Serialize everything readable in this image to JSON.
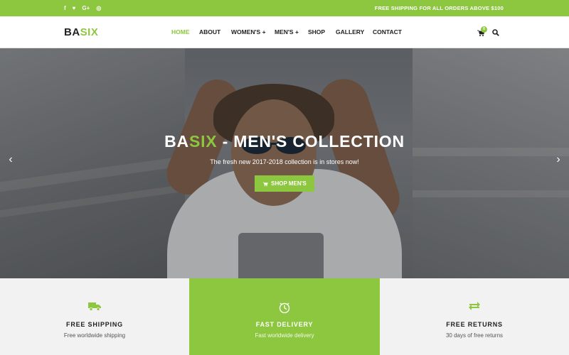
{
  "colors": {
    "accent": "#8dc63f",
    "dark": "#222222",
    "light_panel": "#f2f2f2"
  },
  "topbar": {
    "social": [
      {
        "icon": "facebook-icon",
        "glyph": "f"
      },
      {
        "icon": "twitter-icon",
        "glyph": "♥"
      },
      {
        "icon": "google-plus-icon",
        "glyph": "G+"
      },
      {
        "icon": "instagram-icon",
        "glyph": "◎"
      }
    ],
    "shipping_note": "FREE SHIPPING FOR ALL ORDERS ABOVE $100"
  },
  "header": {
    "logo_dark": "BA",
    "logo_accent": "SIX",
    "nav": [
      {
        "label": "HOME",
        "active": true
      },
      {
        "label": "ABOUT"
      },
      {
        "label": "WOMEN'S +"
      },
      {
        "label": "MEN'S +"
      },
      {
        "label": "SHOP"
      },
      {
        "label": "GALLERY"
      },
      {
        "label": "CONTACT"
      }
    ],
    "cart_count": "0"
  },
  "hero": {
    "title_dark": "BA",
    "title_accent": "SIX",
    "title_rest": " - MEN'S COLLECTION",
    "subtitle": "The fresh new 2017-2018 collection is in stores now!",
    "button_label": "SHOP MEN'S"
  },
  "features": [
    {
      "icon": "truck-icon",
      "title": "FREE SHIPPING",
      "desc": "Free worldwide shipping"
    },
    {
      "icon": "clock-icon",
      "title": "FAST DELIVERY",
      "desc": "Fast worldwide delivery"
    },
    {
      "icon": "exchange-icon",
      "title": "FREE RETURNS",
      "desc": "30 days of free returns"
    }
  ]
}
